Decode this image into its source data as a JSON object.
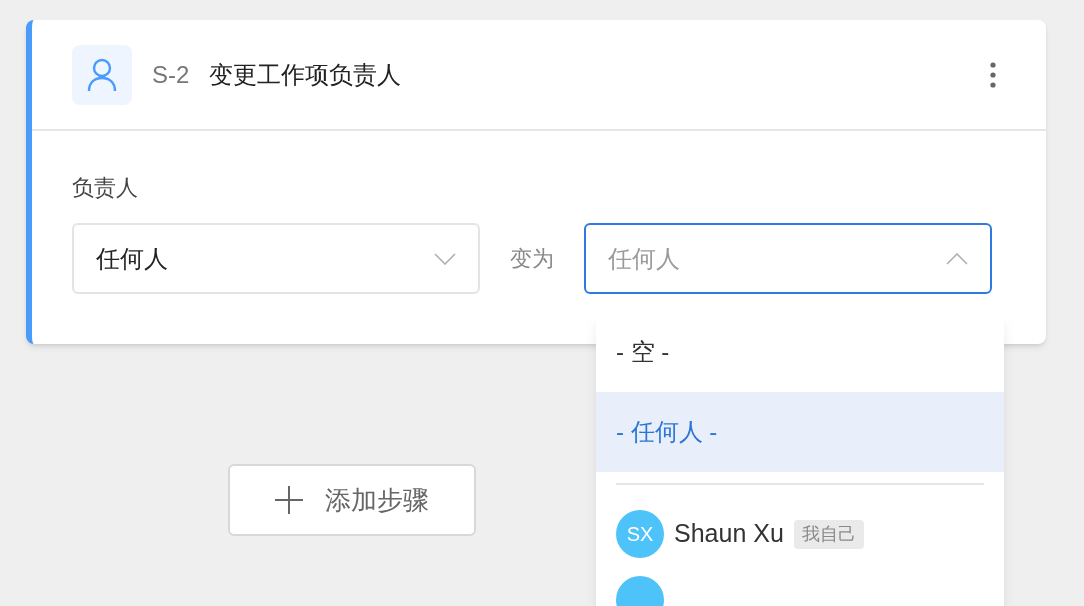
{
  "card": {
    "step_id": "S-2",
    "title": "变更工作项负责人",
    "field_label": "负责人",
    "from_select": {
      "value": "任何人",
      "expanded": false
    },
    "connector": "变为",
    "to_select": {
      "placeholder": "任何人",
      "expanded": true
    }
  },
  "dropdown": {
    "options": [
      {
        "kind": "special",
        "label": "- 空 -",
        "selected": false
      },
      {
        "kind": "special",
        "label": "- 任何人 -",
        "selected": true
      },
      {
        "kind": "divider"
      },
      {
        "kind": "user",
        "initials": "SX",
        "name": "Shaun Xu",
        "badge": "我自己",
        "selected": false
      },
      {
        "kind": "partial"
      }
    ]
  },
  "add_step_button": "添加步骤"
}
